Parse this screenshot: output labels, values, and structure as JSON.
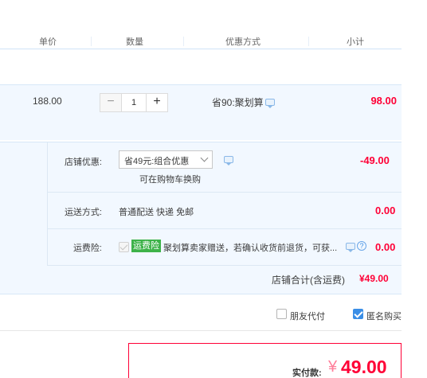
{
  "header": {
    "columns": [
      "单价",
      "数量",
      "优惠方式",
      "小计"
    ]
  },
  "item": {
    "unit_price": "188.00",
    "quantity": "1",
    "minus_label": "−",
    "plus_label": "+",
    "promotion": "省90:聚划算",
    "subtotal": "98.00"
  },
  "shop": {
    "discount_label": "店铺优惠:",
    "discount_select": "省49元:组合优惠",
    "discount_note": "可在购物车换购",
    "discount_value": "-49.00",
    "shipping_label": "运送方式:",
    "shipping_method": "普通配送 快递 免邮",
    "shipping_value": "0.00",
    "insurance_label": "运费险:",
    "insurance_tag": "运费险",
    "insurance_text": "聚划算卖家赠送，若确认收货前退货，可获...",
    "insurance_value": "0.00",
    "help_glyph": "?",
    "total_label": "店铺合计(含运费)",
    "total_value": "¥49.00"
  },
  "options": {
    "friend_pay": "朋友代付",
    "friend_pay_checked": false,
    "anonymous": "匿名购买",
    "anonymous_checked": true
  },
  "payment": {
    "label": "实付款:",
    "currency": "¥",
    "amount": "49.00"
  },
  "colors": {
    "accent_red": "#ff0036",
    "row_bg": "#f2f8ff",
    "checkbox_blue": "#3a8ee6",
    "tag_green": "#3db249"
  }
}
